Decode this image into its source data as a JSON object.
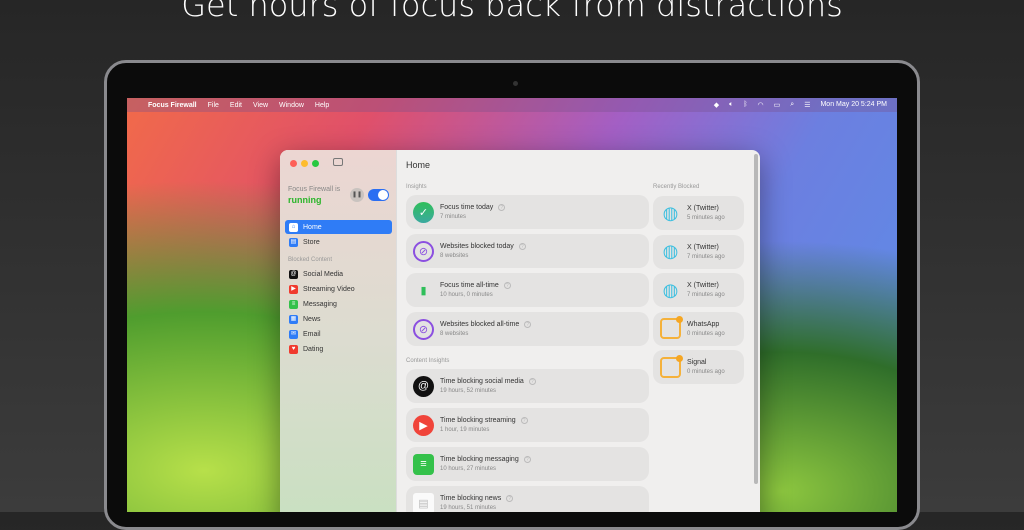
{
  "headline": "Get hours of focus back from distractions",
  "menubar": {
    "app": "Focus Firewall",
    "items": [
      "File",
      "Edit",
      "View",
      "Window",
      "Help"
    ],
    "datetime": "Mon May 20  5:24 PM"
  },
  "sidebar": {
    "status_label": "Focus Firewall is",
    "status_value": "running",
    "nav": [
      {
        "label": "Home",
        "icon": "house-icon",
        "color": "#2f7cf6"
      },
      {
        "label": "Store",
        "icon": "store-icon",
        "color": "#2f7cf6"
      }
    ],
    "blocked_header": "Blocked Content",
    "blocked": [
      {
        "label": "Social Media",
        "color": "#111111"
      },
      {
        "label": "Streaming Video",
        "color": "#f03a2e"
      },
      {
        "label": "Messaging",
        "color": "#34c14a"
      },
      {
        "label": "News",
        "color": "#2f7cf6"
      },
      {
        "label": "Email",
        "color": "#2f7cf6"
      },
      {
        "label": "Dating",
        "color": "#f03a2e"
      }
    ]
  },
  "main": {
    "title": "Home",
    "insights_header": "Insights",
    "insights": [
      {
        "title": "Focus time today",
        "value": "7 minutes"
      },
      {
        "title": "Websites blocked today",
        "value": "8 websites"
      },
      {
        "title": "Focus time all-time",
        "value": "10 hours, 0 minutes"
      },
      {
        "title": "Websites blocked all-time",
        "value": "8 websites"
      }
    ],
    "content_header": "Content Insights",
    "content": [
      {
        "title": "Time blocking social media",
        "value": "19 hours, 52 minutes"
      },
      {
        "title": "Time blocking streaming",
        "value": "1 hour, 19 minutes"
      },
      {
        "title": "Time blocking messaging",
        "value": "10 hours, 27 minutes"
      },
      {
        "title": "Time blocking news",
        "value": "19 hours, 51 minutes"
      }
    ],
    "recent_header": "Recently Blocked",
    "recent": [
      {
        "name": "X (Twitter)",
        "time": "5 minutes ago"
      },
      {
        "name": "X (Twitter)",
        "time": "7 minutes ago"
      },
      {
        "name": "X (Twitter)",
        "time": "7 minutes ago"
      },
      {
        "name": "WhatsApp",
        "time": "0 minutes ago"
      },
      {
        "name": "Signal",
        "time": "0 minutes ago"
      }
    ]
  }
}
